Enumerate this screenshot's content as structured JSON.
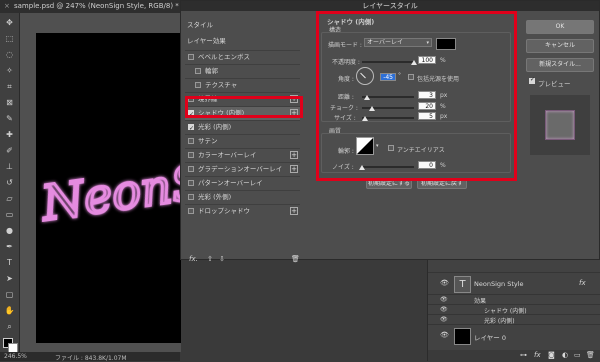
{
  "document_tab": {
    "close": "×",
    "title": "sample.psd @ 247% (NeonSign Style, RGB/8) *"
  },
  "status_bar": {
    "zoom": "246.5%",
    "file_info": "ファイル : 843.8K/1.07M"
  },
  "canvas_text": "NeonSign",
  "dialog": {
    "title": "レイヤースタイル",
    "style_list": {
      "header": "スタイル",
      "blend_options": "レイヤー効果",
      "items": [
        {
          "label": "ベベルとエンボス",
          "checked": false,
          "plus": false
        },
        {
          "label": "輪郭",
          "checked": false,
          "plus": false
        },
        {
          "label": "テクスチャ",
          "checked": false,
          "plus": false
        },
        {
          "label": "境界線",
          "checked": false,
          "plus": true
        },
        {
          "label": "シャドウ (内側)",
          "checked": true,
          "plus": true
        },
        {
          "label": "光彩 (内側)",
          "checked": true,
          "plus": false
        },
        {
          "label": "サテン",
          "checked": false,
          "plus": false
        },
        {
          "label": "カラーオーバーレイ",
          "checked": false,
          "plus": true
        },
        {
          "label": "グラデーションオーバーレイ",
          "checked": false,
          "plus": true
        },
        {
          "label": "パターンオーバーレイ",
          "checked": false,
          "plus": false
        },
        {
          "label": "光彩 (外側)",
          "checked": false,
          "plus": false
        },
        {
          "label": "ドロップシャドウ",
          "checked": false,
          "plus": true
        }
      ],
      "fx": "fx.",
      "up": "⇧",
      "down": "⇩",
      "trash": "🗑"
    },
    "settings": {
      "section_title": "シャドウ (内側)",
      "structure_label": "構造",
      "blend_mode_label": "描画モード :",
      "blend_mode_value": "オーバーレイ",
      "shadow_color": "#000000",
      "opacity_label": "不透明度 :",
      "opacity_value": "100",
      "opacity_unit": "%",
      "opacity_level": 1.0,
      "angle_label": "角度 :",
      "angle_value": "-45",
      "angle_unit": "°",
      "global_light_label": "包括光源を使用",
      "distance_label": "距離 :",
      "distance_value": "3",
      "distance_unit": "px",
      "distance_level": 0.1,
      "choke_label": "チョーク :",
      "choke_value": "20",
      "choke_unit": "%",
      "choke_level": 0.2,
      "size_label": "サイズ :",
      "size_value": "5",
      "size_unit": "px",
      "size_level": 0.05,
      "quality_label": "画質",
      "contour_label": "輪郭 :",
      "antialias_label": "アンチエイリアス",
      "noise_label": "ノイズ :",
      "noise_value": "0",
      "noise_unit": "%",
      "noise_level": 0.0,
      "reset_default": "初期設定にする",
      "restore_default": "初期設定に戻す"
    },
    "buttons": {
      "ok": "OK",
      "cancel": "キャンセル",
      "new_style": "新規スタイル...",
      "preview_label": "プレビュー"
    }
  },
  "layers": {
    "fx_label": "fx",
    "rows": [
      {
        "name": "NeonSign Style",
        "type": "text"
      },
      {
        "name": "効果",
        "type": "effects"
      },
      {
        "name": "シャドウ (内側)",
        "type": "effect"
      },
      {
        "name": "光彩 (内側)",
        "type": "effect"
      },
      {
        "name": "レイヤー 0",
        "type": "image"
      }
    ]
  },
  "colors": {
    "accent_red": "#e0001a",
    "neon_pink": "#e58be0",
    "focus_blue": "#2d6fd6"
  }
}
